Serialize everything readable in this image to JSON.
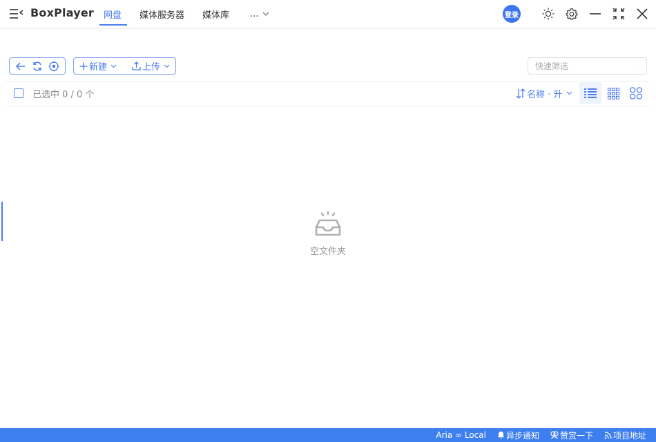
{
  "app": {
    "name": "BoxPlayer"
  },
  "tabs": [
    {
      "label": "网盘",
      "active": true
    },
    {
      "label": "媒体服务器",
      "active": false
    },
    {
      "label": "媒体库",
      "active": false
    }
  ],
  "tabs_more": {
    "label": "..."
  },
  "header": {
    "login_label": "登录"
  },
  "toolbar": {
    "new_label": "新建",
    "upload_label": "上传",
    "search_placeholder": "快速筛选"
  },
  "selection": {
    "text": "已选中 0 / 0 个"
  },
  "sort": {
    "label": "名称 · 升"
  },
  "empty": {
    "text": "空文件夹"
  },
  "status": {
    "aria_label": "Aria ∞ Local",
    "notify_label": "异步通知",
    "reward_label": "赞赏一下",
    "project_label": "项目地址"
  },
  "colors": {
    "accent": "#4a7cf0",
    "statusbar": "#3e7ff0"
  }
}
